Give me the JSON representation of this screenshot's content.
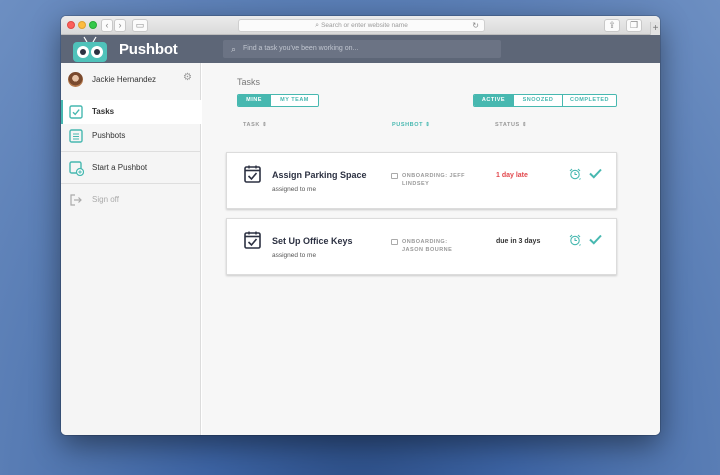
{
  "browser": {
    "address_placeholder": "Search or enter website name"
  },
  "app": {
    "brand": "Pushbot",
    "search_placeholder": "Find a task you've been working on..."
  },
  "sidebar": {
    "user_name": "Jackie Hernandez",
    "items": [
      {
        "label": "Tasks",
        "icon": "task-check-icon",
        "active": true
      },
      {
        "label": "Pushbots",
        "icon": "list-icon",
        "active": false
      },
      {
        "label": "Start a Pushbot",
        "icon": "add-pushbot-icon",
        "active": false
      },
      {
        "label": "Sign off",
        "icon": "sign-off-icon",
        "active": false
      }
    ]
  },
  "main": {
    "title": "Tasks",
    "filter_owner": [
      "MINE",
      "MY TEAM"
    ],
    "filter_owner_selected": "MINE",
    "filter_state": [
      "ACTIVE",
      "SNOOZED",
      "COMPLETED"
    ],
    "filter_state_selected": "ACTIVE",
    "columns": {
      "task": "TASK",
      "pushbot": "PUSHBOT",
      "status": "STATUS"
    },
    "tasks": [
      {
        "title": "Assign Parking Space",
        "assigned": "assigned to me",
        "pushbot_line1": "ONBOARDING: JEFF",
        "pushbot_line2": "LINDSEY",
        "status": "1 day late",
        "late": true
      },
      {
        "title": "Set Up Office Keys",
        "assigned": "assigned to me",
        "pushbot_line1": "ONBOARDING:",
        "pushbot_line2": "JASON BOURNE",
        "status": "due in 3 days",
        "late": false
      }
    ]
  },
  "colors": {
    "accent": "#47b8b0",
    "header": "#5d6677",
    "late": "#e2474c"
  }
}
